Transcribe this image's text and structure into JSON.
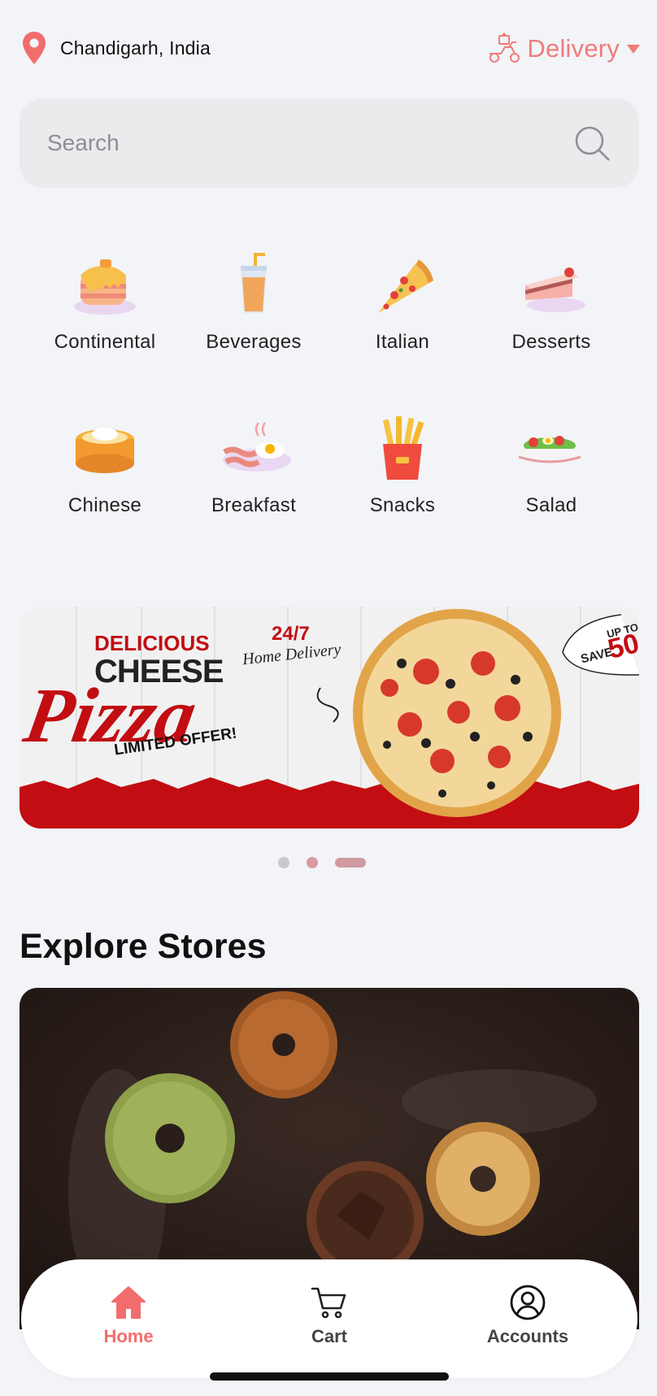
{
  "header": {
    "location": "Chandigarh, India",
    "location_icon": "map-pin-icon",
    "mode_label": "Delivery",
    "mode_icon": "delivery-scooter-icon",
    "accent": "#f27b7b"
  },
  "search": {
    "placeholder": "Search",
    "value": "",
    "icon": "search-icon"
  },
  "categories": [
    {
      "label": "Continental",
      "icon": "pancake-icon"
    },
    {
      "label": "Beverages",
      "icon": "drink-icon"
    },
    {
      "label": "Italian",
      "icon": "pizza-slice-icon"
    },
    {
      "label": "Desserts",
      "icon": "cake-icon"
    },
    {
      "label": "Chinese",
      "icon": "dim-sum-icon"
    },
    {
      "label": "Breakfast",
      "icon": "bacon-egg-icon"
    },
    {
      "label": "Snacks",
      "icon": "fries-icon"
    },
    {
      "label": "Salad",
      "icon": "salad-icon"
    }
  ],
  "banner": {
    "line1": "DELICIOUS",
    "line2": "CHEESE",
    "line3": "Pizza",
    "line4": "LIMITED OFFER!",
    "tag1": "24/7",
    "tag2": "Home Delivery",
    "save_label": "SAVE",
    "upto_label": "UP TO",
    "save_value": "50",
    "carousel_count": 3,
    "carousel_active": 3
  },
  "explore": {
    "title": "Explore Stores"
  },
  "tabbar": {
    "items": [
      {
        "label": "Home",
        "icon": "home-icon",
        "active": true
      },
      {
        "label": "Cart",
        "icon": "cart-icon",
        "active": false
      },
      {
        "label": "Accounts",
        "icon": "account-icon",
        "active": false
      }
    ],
    "active_color": "#f26d6d"
  }
}
